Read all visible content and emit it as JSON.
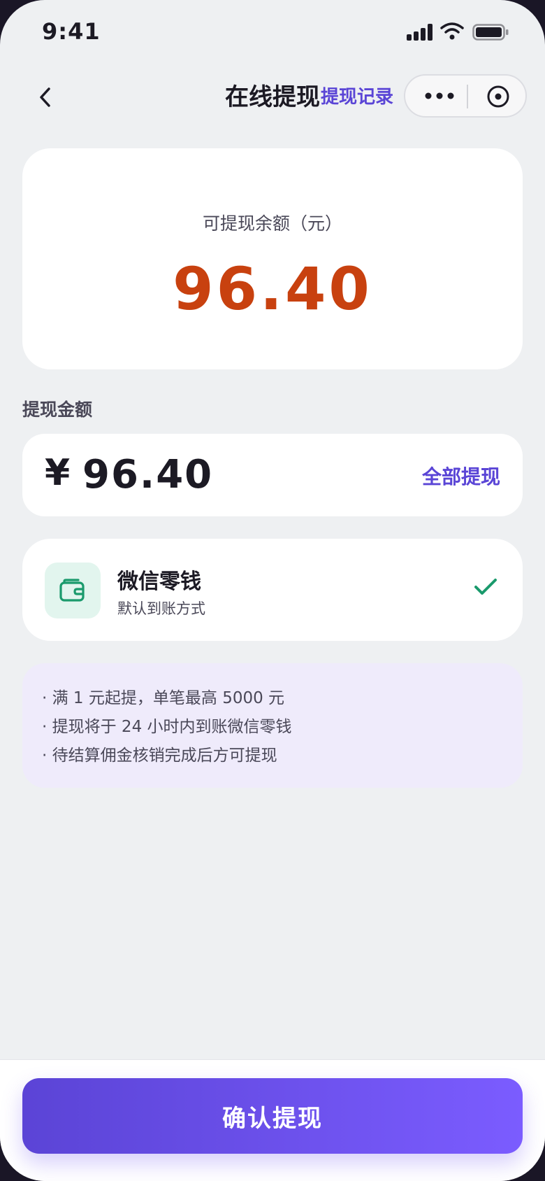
{
  "status_bar": {
    "time": "9:41",
    "icons": [
      "signal-icon",
      "wifi-icon",
      "battery-icon"
    ]
  },
  "nav": {
    "back_icon": "chevron-left-icon",
    "title": "在线提现",
    "link": "提现记录",
    "capsule_icons": [
      "more-icon",
      "target-icon"
    ]
  },
  "balance": {
    "label": "可提现余额（元）",
    "value": "96.40"
  },
  "amount_section": {
    "label": "提现金额",
    "currency": "¥",
    "value": "96.40",
    "withdraw_all": "全部提现"
  },
  "method": {
    "icon": "wallet-icon",
    "name": "微信零钱",
    "subtitle": "默认到账方式",
    "selected": true
  },
  "notes": [
    "· 满 1 元起提，单笔最高 5000 元",
    "· 提现将于 24 小时内到账微信零钱",
    "· 待结算佣金核销完成后方可提现"
  ],
  "confirm_button": "确认提现",
  "colors": {
    "accent": "#5a45d6",
    "amount": "#c8410f",
    "wallet": "#1a9a6c",
    "button_gradient": [
      "#5b44d6",
      "#7b5cff"
    ]
  }
}
